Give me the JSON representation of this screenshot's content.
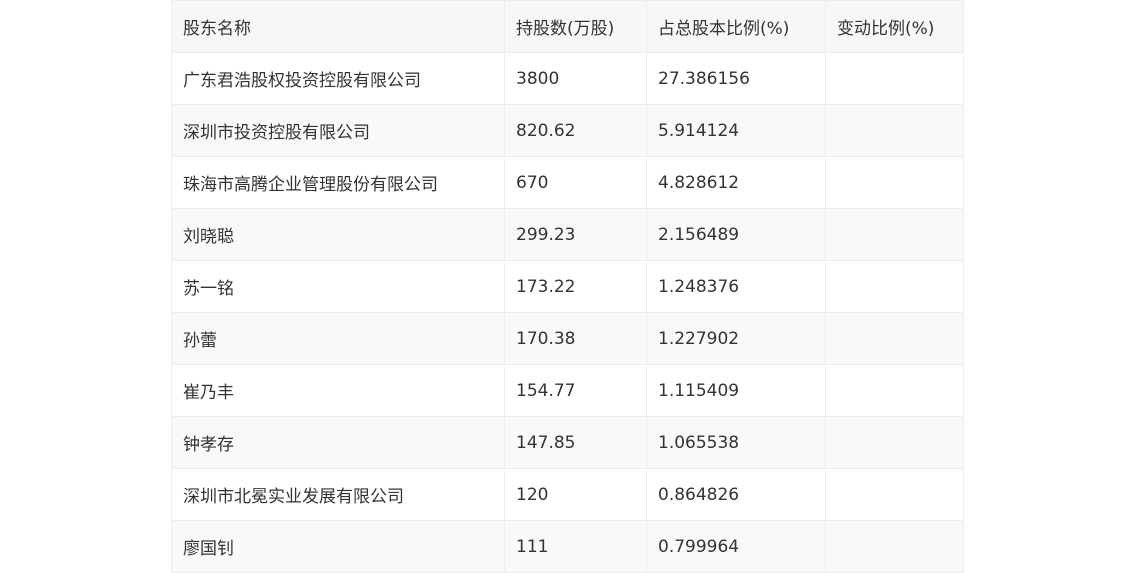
{
  "table": {
    "headers": [
      "股东名称",
      "持股数(万股)",
      "占总股本比例(%)",
      "变动比例(%)"
    ],
    "rows": [
      [
        "广东君浩股权投资控股有限公司",
        "3800",
        "27.386156",
        ""
      ],
      [
        "深圳市投资控股有限公司",
        "820.62",
        "5.914124",
        ""
      ],
      [
        "珠海市高腾企业管理股份有限公司",
        "670",
        "4.828612",
        ""
      ],
      [
        "刘晓聪",
        "299.23",
        "2.156489",
        ""
      ],
      [
        "苏一铭",
        "173.22",
        "1.248376",
        ""
      ],
      [
        "孙蕾",
        "170.38",
        "1.227902",
        ""
      ],
      [
        "崔乃丰",
        "154.77",
        "1.115409",
        ""
      ],
      [
        "钟孝存",
        "147.85",
        "1.065538",
        ""
      ],
      [
        "深圳市北冕实业发展有限公司",
        "120",
        "0.864826",
        ""
      ],
      [
        "廖国钊",
        "111",
        "0.799964",
        ""
      ]
    ]
  }
}
